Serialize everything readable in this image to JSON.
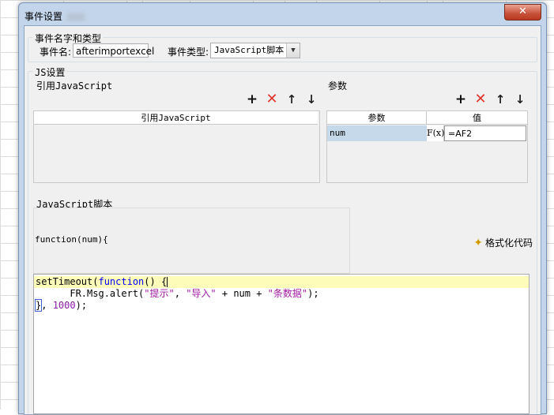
{
  "dialog": {
    "title": "事件设置",
    "close_glyph": "✕"
  },
  "event_group": {
    "title": "事件名字和类型",
    "name_label": "事件名:",
    "name_value": "afterimportexcel",
    "type_label": "事件类型:",
    "type_value": "JavaScript脚本"
  },
  "js_group": {
    "title": "JS设置",
    "ref_js": {
      "title": "引用JavaScript",
      "column_header": "引用JavaScript"
    },
    "params": {
      "title": "参数",
      "headers": [
        "参数",
        "值"
      ],
      "rows": [
        {
          "name": "num",
          "formula_icon": "F(x)",
          "value": "=AF2"
        }
      ]
    },
    "toolbar_icons": [
      "add-icon",
      "delete-icon",
      "move-up-icon",
      "move-down-icon"
    ],
    "script": {
      "title": "JavaScript脚本",
      "function_header": "function(num){",
      "format_label": "格式化代码",
      "code_lines": [
        "setTimeout(function() {",
        "      FR.Msg.alert(\"提示\", \"导入\" + num + \"条数据\");",
        "}, 1000);"
      ]
    }
  },
  "colors": {
    "dialog_frame": "#c3d5ea",
    "client_bg": "#f0f0f0",
    "close_button": "#c7503a",
    "delete_icon": "#e2352a",
    "keyword": "#0000ff",
    "string": "#a11ba1",
    "current_line": "#fdfdb9",
    "param_row_selected": "#c5d9ea"
  }
}
